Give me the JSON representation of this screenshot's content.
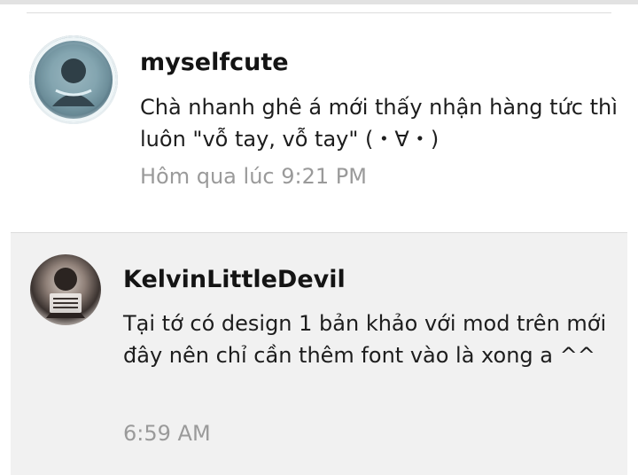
{
  "comments": [
    {
      "username": "myselfcute",
      "text": "Chà nhanh ghê á mới thấy nhận hàng tức thì luôn \"vỗ tay, vỗ tay\" (・∀・)",
      "timestamp": "Hôm qua lúc 9:21 PM",
      "avatar_icon": "user-avatar"
    },
    {
      "username": "KelvinLittleDevil",
      "text": "Tại tớ có design 1 bản khảo với mod trên mới đây nên chỉ cần thêm font vào là xong a ^^",
      "timestamp": "6:59 AM",
      "avatar_icon": "user-avatar"
    }
  ]
}
